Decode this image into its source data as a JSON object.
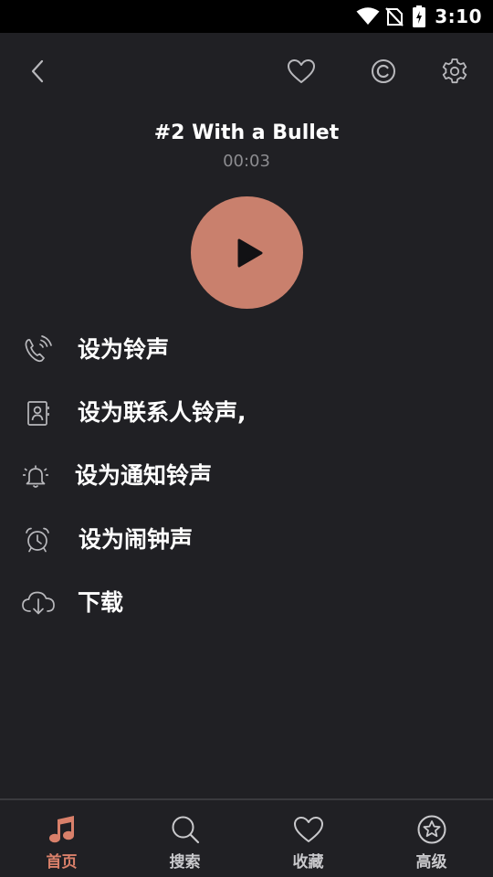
{
  "status_bar": {
    "time": "3:10"
  },
  "track": {
    "title": "#2 With a Bullet",
    "time": "00:03"
  },
  "colors": {
    "accent": "#c9806d",
    "background": "#202024",
    "nav_active": "#d9806a"
  },
  "actions": [
    {
      "label": "设为铃声",
      "icon": "phone-ringing-icon"
    },
    {
      "label": "设为联系人铃声,",
      "icon": "contact-card-icon"
    },
    {
      "label": "设为通知铃声",
      "icon": "bell-icon"
    },
    {
      "label": "设为闹钟声",
      "icon": "alarm-clock-icon"
    },
    {
      "label": "下载",
      "icon": "cloud-download-icon"
    }
  ],
  "bottom_nav": [
    {
      "label": "首页",
      "icon": "music-note-icon",
      "active": true
    },
    {
      "label": "搜索",
      "icon": "search-icon",
      "active": false
    },
    {
      "label": "收藏",
      "icon": "heart-icon",
      "active": false
    },
    {
      "label": "高级",
      "icon": "star-circle-icon",
      "active": false
    }
  ]
}
